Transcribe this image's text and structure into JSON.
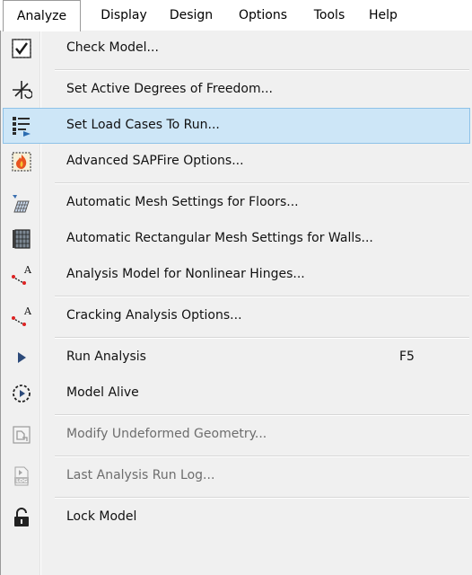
{
  "menubar": {
    "items": [
      "Analyze",
      "Display",
      "Design",
      "Options",
      "Tools",
      "Help"
    ],
    "active": "Analyze"
  },
  "menu": {
    "items": [
      {
        "label": "Check Model...",
        "icon": "check-model-icon",
        "enabled": true
      },
      {
        "label": "Set Active Degrees of Freedom...",
        "icon": "degrees-of-freedom-icon",
        "enabled": true
      },
      {
        "label": "Set Load Cases To Run...",
        "icon": "load-cases-icon",
        "enabled": true,
        "highlighted": true
      },
      {
        "label": "Advanced SAPFire Options...",
        "icon": "sapfire-icon",
        "enabled": true
      },
      {
        "label": "Automatic Mesh Settings for Floors...",
        "icon": "floor-mesh-icon",
        "enabled": true
      },
      {
        "label": "Automatic Rectangular Mesh Settings for Walls...",
        "icon": "wall-mesh-icon",
        "enabled": true
      },
      {
        "label": "Analysis Model for Nonlinear Hinges...",
        "icon": "nonlinear-hinges-icon",
        "enabled": true
      },
      {
        "label": "Cracking Analysis Options...",
        "icon": "cracking-analysis-icon",
        "enabled": true
      },
      {
        "label": "Run Analysis",
        "icon": "run-analysis-icon",
        "enabled": true,
        "shortcut": "F5"
      },
      {
        "label": "Model Alive",
        "icon": "model-alive-icon",
        "enabled": true
      },
      {
        "label": "Modify Undeformed Geometry...",
        "icon": "modify-geometry-icon",
        "enabled": false
      },
      {
        "label": "Last Analysis Run Log...",
        "icon": "run-log-icon",
        "enabled": false
      },
      {
        "label": "Lock Model",
        "icon": "lock-icon",
        "enabled": true
      }
    ]
  },
  "colors": {
    "highlight_bg": "#cde6f7",
    "highlight_border": "#8ec2e8",
    "disabled_text": "#6d6d6d",
    "menu_bg": "#f0f0f0"
  }
}
